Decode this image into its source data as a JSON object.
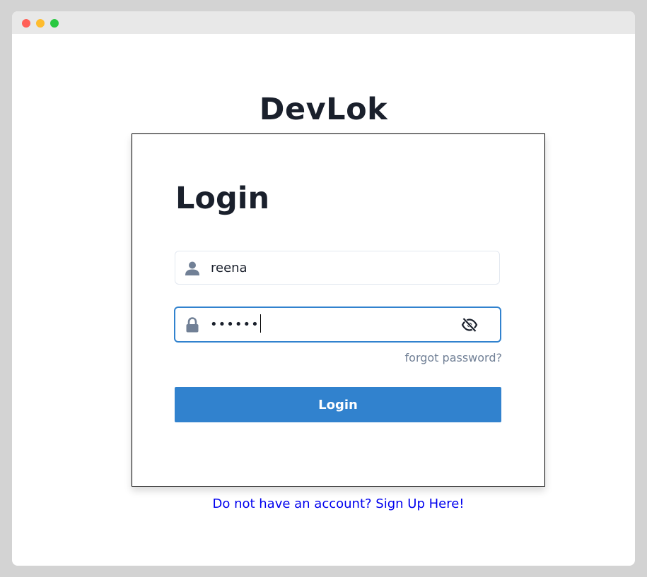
{
  "app": {
    "brand_title": "DevLok"
  },
  "login_card": {
    "title": "Login",
    "username": {
      "value": "reena",
      "icon": "user-icon"
    },
    "password": {
      "masked_value": "••••••",
      "icon": "lock-icon",
      "toggle_icon": "eye-off-icon"
    },
    "forgot_password_label": "forgot password?",
    "submit_label": "Login"
  },
  "footer": {
    "signup_link_text": "Do not have an account? Sign Up Here!"
  },
  "colors": {
    "accent": "#3182ce",
    "heading": "#1a202c",
    "muted": "#718096",
    "link": "#0000ee"
  }
}
